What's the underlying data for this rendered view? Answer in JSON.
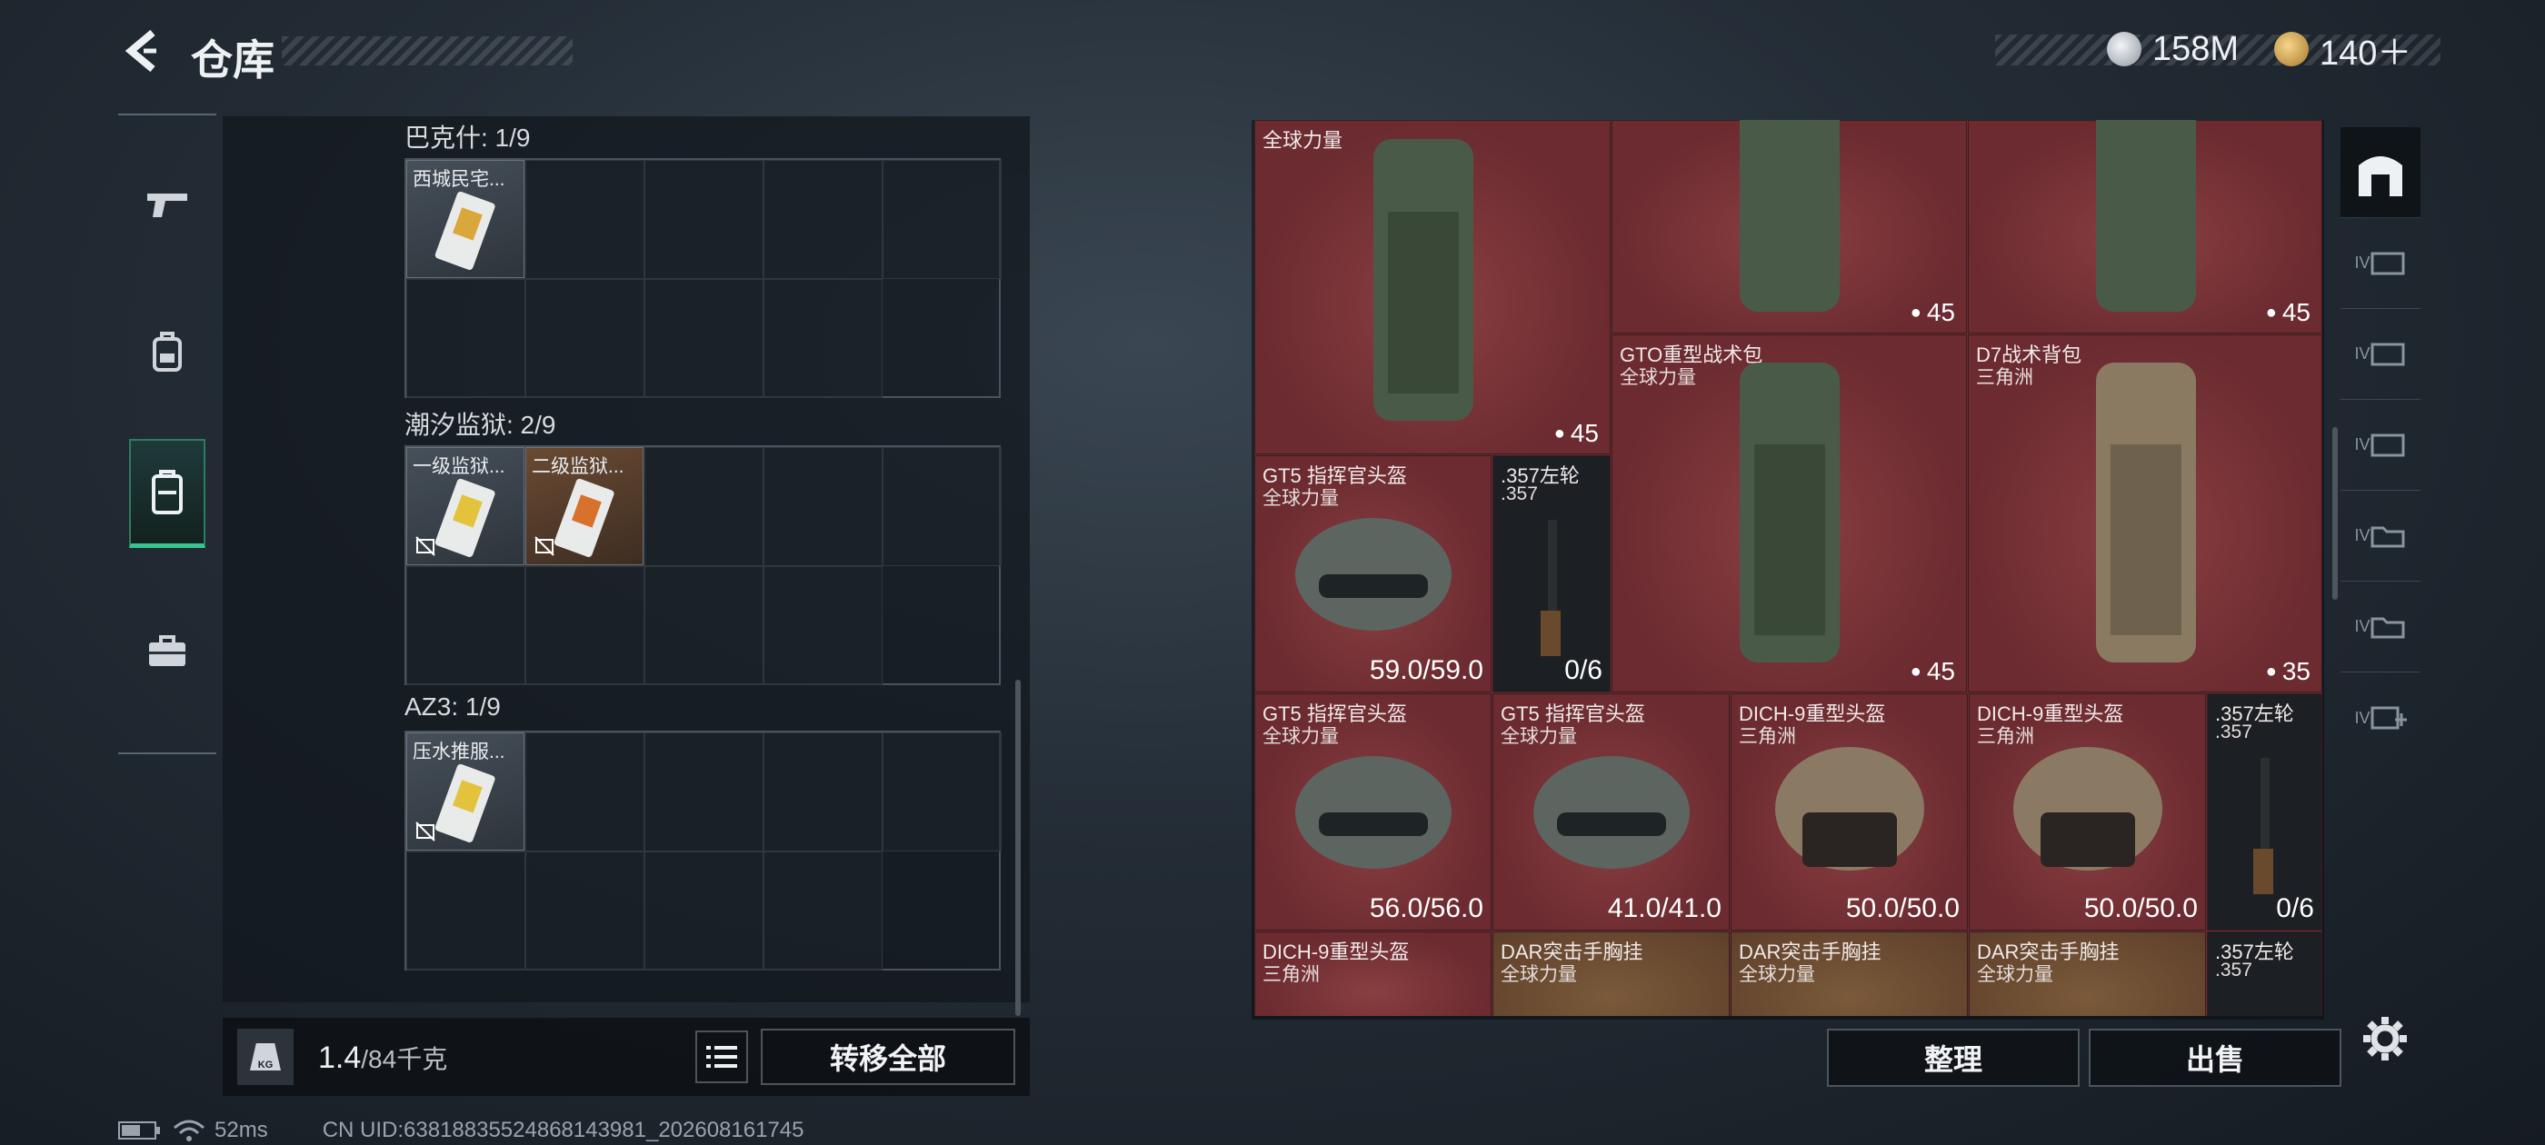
{
  "header": {
    "title": "仓库",
    "currency_1": "158M",
    "currency_2": "140＋"
  },
  "left_nav": [
    "pistol-icon",
    "backpack-icon",
    "vest-icon",
    "briefcase-icon"
  ],
  "groups": [
    {
      "label": "巴克什: 1/9",
      "items": [
        {
          "name": "西城民宅...",
          "locked": false
        }
      ]
    },
    {
      "label": "潮汐监狱: 2/9",
      "items": [
        {
          "name": "一级监狱...",
          "locked": true
        },
        {
          "name": "二级监狱...",
          "locked": true
        }
      ]
    },
    {
      "label": "AZ3: 1/9",
      "items": [
        {
          "name": "压水推服...",
          "locked": true
        }
      ]
    }
  ],
  "weight": {
    "current": "1.4",
    "max": "/84千克",
    "transfer_label": "转移全部",
    "kg_icon_label": "KG"
  },
  "right_items": [
    {
      "line1": "",
      "line2": "全球力量",
      "value": "45",
      "kind": "capacity"
    },
    {
      "line1": "",
      "line2": "",
      "value": "45",
      "kind": "capacity"
    },
    {
      "line1": "",
      "line2": "",
      "value": "45",
      "kind": "capacity"
    },
    {
      "line1": "GTO重型战术包",
      "line2": "全球力量",
      "value": "45",
      "kind": "capacity"
    },
    {
      "line1": "D7战术背包",
      "line2": "三角洲",
      "value": "35",
      "kind": "capacity"
    },
    {
      "line1": "GT5 指挥官头盔",
      "line2": "全球力量",
      "value": "59.0/59.0",
      "kind": "durability"
    },
    {
      "line1": ".357左轮",
      "line2": ".357",
      "value": "0/6",
      "kind": "ammo"
    },
    {
      "line1": "GT5 指挥官头盔",
      "line2": "全球力量",
      "value": "56.0/56.0",
      "kind": "durability"
    },
    {
      "line1": "GT5 指挥官头盔",
      "line2": "全球力量",
      "value": "41.0/41.0",
      "kind": "durability"
    },
    {
      "line1": "DICH-9重型头盔",
      "line2": "三角洲",
      "value": "50.0/50.0",
      "kind": "durability"
    },
    {
      "line1": "DICH-9重型头盔",
      "line2": "三角洲",
      "value": "50.0/50.0",
      "kind": "durability"
    },
    {
      "line1": ".357左轮",
      "line2": ".357",
      "value": "0/6",
      "kind": "ammo"
    },
    {
      "line1": "DICH-9重型头盔",
      "line2": "三角洲",
      "value": "",
      "kind": "durability"
    },
    {
      "line1": "DAR突击手胸挂",
      "line2": "全球力量",
      "value": "",
      "kind": "none"
    },
    {
      "line1": "DAR突击手胸挂",
      "line2": "全球力量",
      "value": "",
      "kind": "none"
    },
    {
      "line1": "DAR突击手胸挂",
      "line2": "全球力量",
      "value": "",
      "kind": "none"
    },
    {
      "line1": ".357左轮",
      "line2": ".357",
      "value": "",
      "kind": "none"
    }
  ],
  "right_nav": {
    "roman": [
      "IV",
      "IV",
      "IV",
      "IV",
      "IV",
      "IV"
    ]
  },
  "actions": {
    "organize": "整理",
    "sell": "出售"
  },
  "status": {
    "ping": "52ms",
    "uid": "CN UID:63818835524868143981_202608161745"
  },
  "colors": {
    "accent": "#37c48e",
    "item_bg": "#6b2b30"
  }
}
